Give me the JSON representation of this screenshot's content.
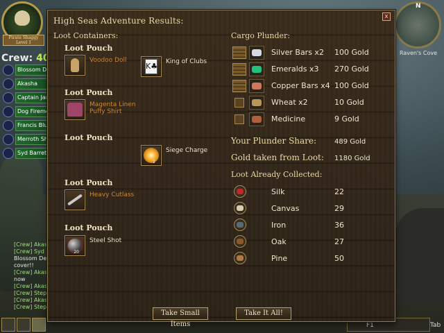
{
  "hud": {
    "emblem_banner": "Pirate Shaggy Level 1",
    "crew_label": "Crew:",
    "crew_pct": "40%",
    "crew": [
      "Blossom Dee",
      "Akasha",
      "Captain Jame",
      "Dog Firemon",
      "Francis Blues",
      "Merroth Shaw",
      "Syd Barrett"
    ],
    "chat": [
      {
        "text": "[Crew] Akash",
        "kind": "c"
      },
      {
        "text": "[Crew] Syd Ba",
        "kind": "c"
      },
      {
        "text": "Blossom Dee",
        "kind": "w"
      },
      {
        "text": "cover!!",
        "kind": "w"
      },
      {
        "text": "[Crew] Akash",
        "kind": "c"
      },
      {
        "text": "now",
        "kind": "w"
      },
      {
        "text": "[Crew] Akash",
        "kind": "c"
      },
      {
        "text": "[Crew] Stephe",
        "kind": "c"
      },
      {
        "text": "[Crew] Akash",
        "kind": "c"
      },
      {
        "text": "[Crew] Stephe",
        "kind": "c"
      }
    ],
    "compass_n": "N",
    "location": "Raven's Cove",
    "f1": "F1",
    "tab": "Tab"
  },
  "dialog": {
    "title": "High Seas Adventure Results:",
    "close": "x",
    "loot_heading": "Loot Containers:",
    "cargo_heading": "Cargo Plunder:",
    "pouches": [
      {
        "label": "Loot Pouch"
      },
      {
        "label": "Loot Pouch"
      },
      {
        "label": "Loot Pouch"
      },
      {
        "label": "Loot Pouch"
      },
      {
        "label": "Loot Pouch"
      }
    ],
    "items": {
      "voodoo_doll": "Voodoo Doll",
      "king_of_clubs": "King of Clubs",
      "card_glyph": "K♣",
      "shirt": "Magenta Linen Puffy Shirt",
      "siege_charge": "Siege Charge",
      "siege_count": "2",
      "heavy_cutlass": "Heavy Cutlass",
      "steel_shot": "Steel Shot",
      "steel_count": "20"
    },
    "cargo": [
      {
        "name": "Silver Bars x2",
        "value": "100 Gold",
        "color": "#d8d8e0"
      },
      {
        "name": "Emeralds x3",
        "value": "270 Gold",
        "color": "#22c07a"
      },
      {
        "name": "Copper Bars x4",
        "value": "100 Gold",
        "color": "#d0785a"
      },
      {
        "name": "Wheat x2",
        "value": "10 Gold",
        "color": "#b8955a"
      },
      {
        "name": "Medicine",
        "value": "9 Gold",
        "color": "#b0603a"
      }
    ],
    "share_label": "Your Plunder Share:",
    "share_value": "489 Gold",
    "taken_label": "Gold taken from Loot:",
    "taken_value": "1180 Gold",
    "collected_heading": "Loot Already Collected:",
    "materials": [
      {
        "name": "Silk",
        "qty": "22",
        "color": "#c0282a"
      },
      {
        "name": "Canvas",
        "qty": "29",
        "color": "#d9cfb0"
      },
      {
        "name": "Iron",
        "qty": "36",
        "color": "#5a6a78"
      },
      {
        "name": "Oak",
        "qty": "27",
        "color": "#8a5a2a"
      },
      {
        "name": "Pine",
        "qty": "50",
        "color": "#b07a45"
      }
    ],
    "take_small_label": "Take Small Items",
    "take_all_label": "Take It All!"
  }
}
